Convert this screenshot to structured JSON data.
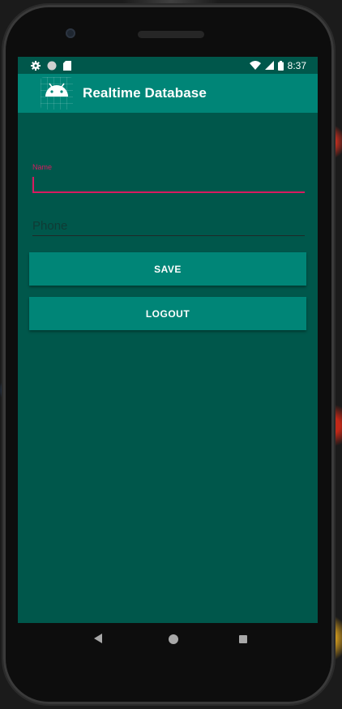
{
  "status_bar": {
    "time": "8:37",
    "icons_left": [
      "gear-icon",
      "circle-icon",
      "sim-card-icon"
    ],
    "icons_right": [
      "wifi-icon",
      "signal-icon",
      "battery-icon"
    ]
  },
  "app_bar": {
    "title": "Realtime Database",
    "logo_icon": "android-icon"
  },
  "form": {
    "name_label": "Name",
    "name_value": "",
    "phone_placeholder": "Phone",
    "phone_value": ""
  },
  "buttons": {
    "save_label": "SAVE",
    "logout_label": "LOGOUT"
  },
  "nav": {
    "back_icon": "back-triangle-icon",
    "home_icon": "home-circle-icon",
    "recents_icon": "recents-square-icon"
  },
  "colors": {
    "primary": "#008577",
    "primary_dark": "#00574B",
    "accent": "#D81B60"
  }
}
